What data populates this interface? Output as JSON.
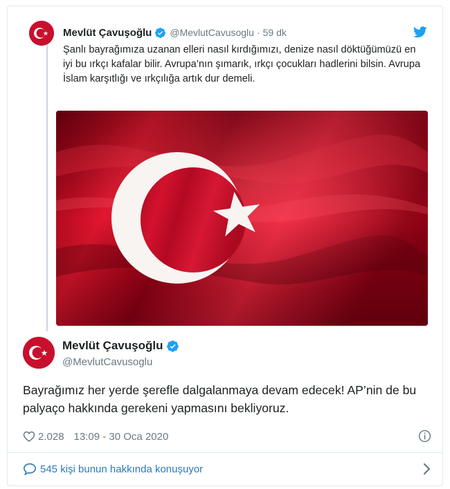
{
  "quoted_tweet": {
    "author_name": "Mevlüt Çavuşoğlu",
    "author_handle": "@MevlutCavusoglu",
    "separator": "·",
    "time": "59 dk",
    "text": "Şanlı bayrağımıza uzanan elleri nasıl kırdığımızı, denize nasıl döktüğümüzü en iyi bu ırkçı kafalar bilir. Avrupa’nın şımarık, ırkçı çocukları hadlerini bilsin. Avrupa İslam karşıtlığı ve ırkçılığa artık dur demeli.",
    "media_icon": "turkish-flag-image"
  },
  "main_tweet": {
    "author_name": "Mevlüt Çavuşoğlu",
    "author_handle": "@MevlutCavusoglu",
    "text": "Bayrağımız her yerde şerefle dalgalanmaya devam edecek! AP’nin de bu palyaço hakkında gerekeni yapmasını bekliyoruz.",
    "likes": "2.028",
    "timestamp": "13:09 - 30 Oca 2020"
  },
  "footer": {
    "conversation_text": "545 kişi bunun hakkında konuşuyor"
  },
  "colors": {
    "verified_blue": "#1da1f2",
    "link_blue": "#2b7bb9",
    "flag_red": "#c8102e",
    "muted": "#697882"
  },
  "icons": [
    "twitter-bird-icon",
    "verified-icon",
    "heart-icon",
    "info-icon",
    "speech-bubble-icon",
    "chevron-right-icon"
  ]
}
